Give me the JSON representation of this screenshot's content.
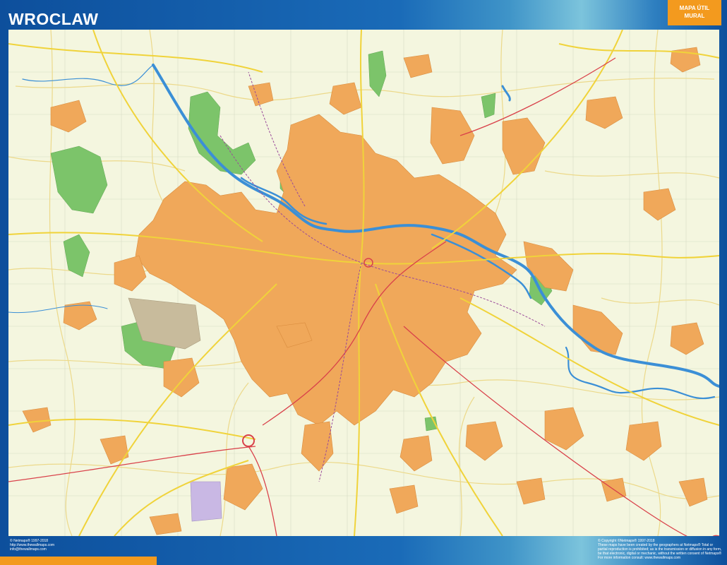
{
  "title": "WROCLAW",
  "badge": {
    "line1": "MAPA ÚTIL",
    "line2": "MURAL"
  },
  "footer_left": [
    "© Netmaps® 1997-2018",
    "http://www.thewallmaps.com",
    "info@thewallmaps.com"
  ],
  "footer_right": [
    "© Copyright ©Netmaps® 1997-2018",
    "These maps have been created by the geographers at Netmaps® Total or partial reproduction is prohibited; as is the transmission or diffusion in any form, be that electronic, digital or mechanic, without the written consent of Netmaps®",
    "For more information consult: www.thewallmaps.com"
  ],
  "colors": {
    "frame": "#1560a8",
    "accent": "#f39a1e",
    "map_background": "#f4f6df",
    "urban": "#f0a85a",
    "park": "#7cc46a",
    "water": "#3b8fd6",
    "major_road": "#f0d33a",
    "motorway": "#d9414a",
    "rail": "#9a4a9a",
    "airport": "#c8bb9c",
    "industrial": "#c9b8e4"
  },
  "map": {
    "city": "Wroclaw",
    "river": "Odra"
  }
}
